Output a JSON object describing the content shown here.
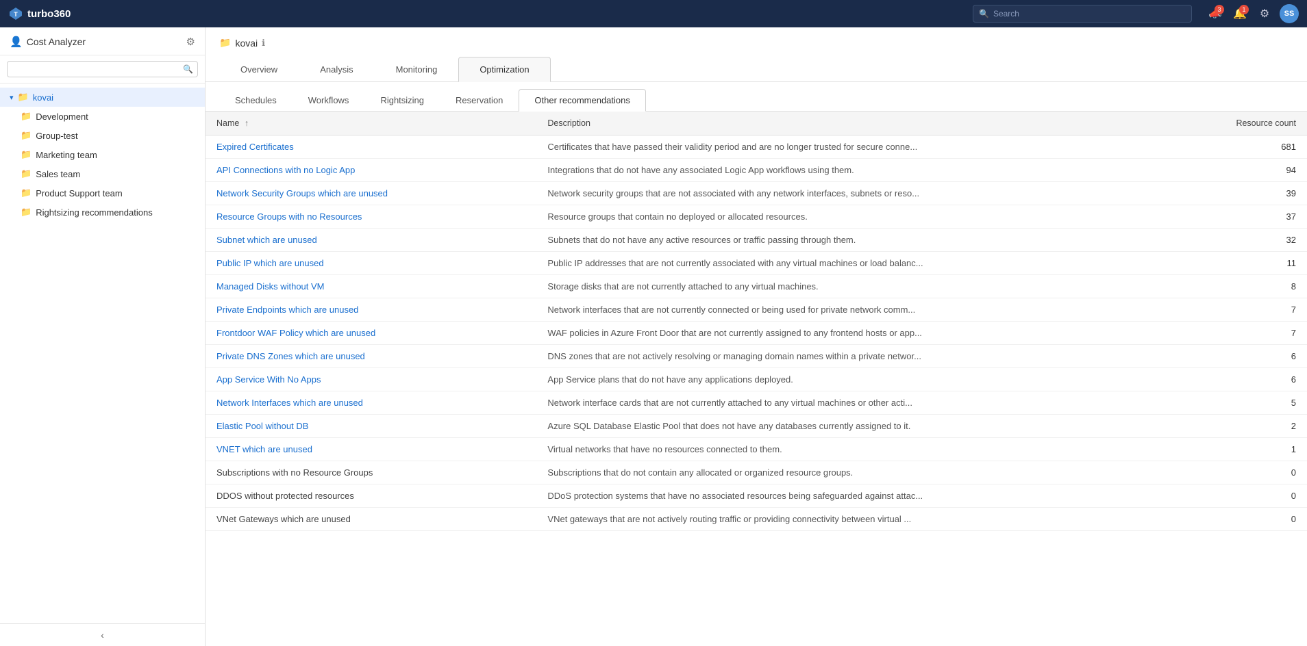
{
  "app": {
    "name": "turbo360",
    "logo_text": "turbo360"
  },
  "navbar": {
    "search_placeholder": "Search",
    "bell_badge": "1",
    "notification_badge": "3",
    "avatar": "SS",
    "gear_visible": true
  },
  "sidebar": {
    "title": "Cost Analyzer",
    "search_placeholder": "",
    "tree": {
      "root": "kovai",
      "children": [
        "Development",
        "Group-test",
        "Marketing team",
        "Sales team",
        "Product Support team",
        "Rightsizing recommendations"
      ]
    }
  },
  "content": {
    "breadcrumb": "kovai",
    "tabs": [
      "Overview",
      "Analysis",
      "Monitoring",
      "Optimization"
    ],
    "active_tab": "Optimization",
    "sub_tabs": [
      "Schedules",
      "Workflows",
      "Rightsizing",
      "Reservation",
      "Other recommendations"
    ],
    "active_sub_tab": "Other recommendations"
  },
  "table": {
    "columns": [
      "Name",
      "Description",
      "Resource count"
    ],
    "rows": [
      {
        "name": "Expired Certificates",
        "description": "Certificates that have passed their validity period and are no longer trusted for secure conne...",
        "count": "681",
        "link": true
      },
      {
        "name": "API Connections with no Logic App",
        "description": "Integrations that do not have any associated Logic App workflows using them.",
        "count": "94",
        "link": true
      },
      {
        "name": "Network Security Groups which are unused",
        "description": "Network security groups that are not associated with any network interfaces, subnets or reso...",
        "count": "39",
        "link": true
      },
      {
        "name": "Resource Groups with no Resources",
        "description": "Resource groups that contain no deployed or allocated resources.",
        "count": "37",
        "link": true
      },
      {
        "name": "Subnet which are unused",
        "description": "Subnets that do not have any active resources or traffic passing through them.",
        "count": "32",
        "link": true
      },
      {
        "name": "Public IP which are unused",
        "description": "Public IP addresses that are not currently associated with any virtual machines or load balanc...",
        "count": "11",
        "link": true
      },
      {
        "name": "Managed Disks without VM",
        "description": "Storage disks that are not currently attached to any virtual machines.",
        "count": "8",
        "link": true
      },
      {
        "name": "Private Endpoints which are unused",
        "description": "Network interfaces that are not currently connected or being used for private network comm...",
        "count": "7",
        "link": true
      },
      {
        "name": "Frontdoor WAF Policy which are unused",
        "description": "WAF policies in Azure Front Door that are not currently assigned to any frontend hosts or app...",
        "count": "7",
        "link": true
      },
      {
        "name": "Private DNS Zones which are unused",
        "description": "DNS zones that are not actively resolving or managing domain names within a private networ...",
        "count": "6",
        "link": true
      },
      {
        "name": "App Service With No Apps",
        "description": "App Service plans that do not have any applications deployed.",
        "count": "6",
        "link": true
      },
      {
        "name": "Network Interfaces which are unused",
        "description": "Network interface cards that are not currently attached to any virtual machines or other acti...",
        "count": "5",
        "link": true
      },
      {
        "name": "Elastic Pool without DB",
        "description": "Azure SQL Database Elastic Pool that does not have any databases currently assigned to it.",
        "count": "2",
        "link": true
      },
      {
        "name": "VNET which are unused",
        "description": "Virtual networks that have no resources connected to them.",
        "count": "1",
        "link": true
      },
      {
        "name": "Subscriptions with no Resource Groups",
        "description": "Subscriptions that do not contain any allocated or organized resource groups.",
        "count": "0",
        "link": false
      },
      {
        "name": "DDOS without protected resources",
        "description": "DDoS protection systems that have no associated resources being safeguarded against attac...",
        "count": "0",
        "link": false
      },
      {
        "name": "VNet Gateways which are unused",
        "description": "VNet gateways that are not actively routing traffic or providing connectivity between virtual ...",
        "count": "0",
        "link": false
      }
    ]
  },
  "icons": {
    "search": "🔍",
    "folder": "📁",
    "gear": "⚙",
    "bell": "🔔",
    "megaphone": "📣",
    "chevron_down": "▾",
    "chevron_left": "‹",
    "sort_asc": "↑",
    "collapse": "‹"
  }
}
